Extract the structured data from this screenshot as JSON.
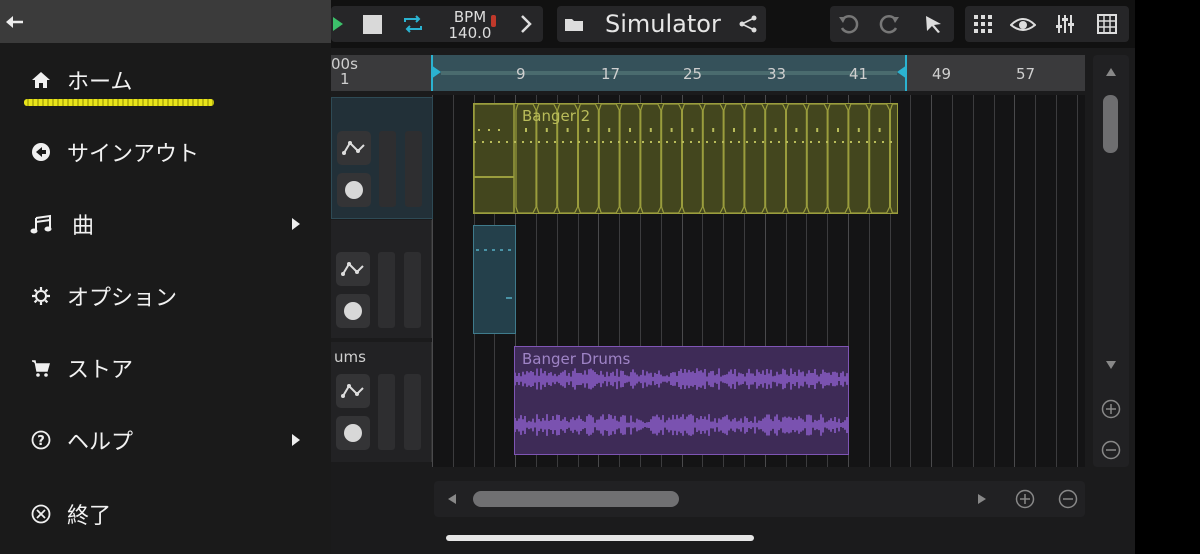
{
  "menu": {
    "back_icon": "back-arrow-icon",
    "items": [
      {
        "label": "ホーム",
        "icon": "home-icon",
        "submenu": false
      },
      {
        "label": "サインアウト",
        "icon": "sign-out-icon",
        "submenu": false
      },
      {
        "label": "曲",
        "icon": "music-note-icon",
        "submenu": true
      },
      {
        "label": "オプション",
        "icon": "gear-icon",
        "submenu": false
      },
      {
        "label": "ストア",
        "icon": "cart-icon",
        "submenu": false
      },
      {
        "label": "ヘルプ",
        "icon": "help-icon",
        "submenu": true
      },
      {
        "label": "終了",
        "icon": "close-circle-icon",
        "submenu": false
      }
    ]
  },
  "toolbar": {
    "bpm_label": "BPM",
    "bpm_value": "140.0",
    "project_name": "Simulator"
  },
  "timeline": {
    "time_readout_1": "00s",
    "time_readout_2": "1",
    "bar_numbers": [
      "9",
      "17",
      "25",
      "33",
      "41",
      "49",
      "57"
    ]
  },
  "tracks": [
    {
      "label": "",
      "clip": "Banger 2"
    },
    {
      "label": "",
      "clip": ""
    },
    {
      "label": "ums",
      "clip": "Banger Drums"
    }
  ],
  "colors": {
    "yellow_clip": "#9a9d3d",
    "blue_clip": "#3f7b8c",
    "purple_clip": "#7f55b5",
    "play_green": "#3cc06a",
    "loop_cyan": "#2bb3d1",
    "highlight": "#e8e41a"
  }
}
